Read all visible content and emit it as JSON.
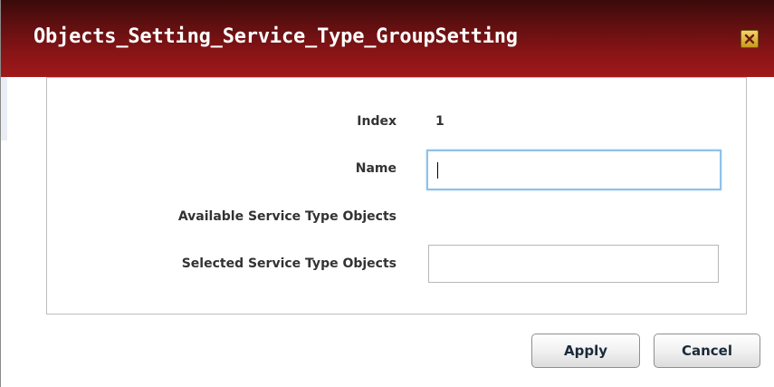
{
  "dialog": {
    "title": "Objects_Setting_Service_Type_GroupSetting",
    "close_icon": "close-icon"
  },
  "form": {
    "index_label": "Index",
    "index_value": "1",
    "name_label": "Name",
    "name_value": "",
    "available_label": "Available Service Type Objects",
    "selected_label": "Selected Service Type Objects",
    "selected_value": ""
  },
  "actions": {
    "apply_label": "Apply",
    "cancel_label": "Cancel"
  },
  "colors": {
    "title_bar_dark": "#3a0a0a",
    "title_bar_light": "#a0191b",
    "focus_border": "#8ec1e8",
    "close_button": "#e0b43a"
  }
}
